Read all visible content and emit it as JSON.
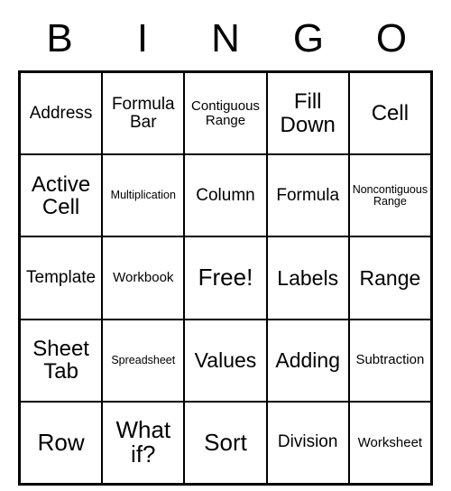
{
  "header": [
    "B",
    "I",
    "N",
    "G",
    "O"
  ],
  "grid": [
    [
      {
        "t": "Address",
        "s": "s-sm"
      },
      {
        "t": "Formula Bar",
        "s": "s-sm"
      },
      {
        "t": "Contiguous Range",
        "s": "s-xs"
      },
      {
        "t": "Fill Down",
        "s": "s-lg"
      },
      {
        "t": "Cell",
        "s": "s-lg"
      }
    ],
    [
      {
        "t": "Active Cell",
        "s": "s-lg"
      },
      {
        "t": "Multiplication",
        "s": "s-xxs"
      },
      {
        "t": "Column",
        "s": "s-sm"
      },
      {
        "t": "Formula",
        "s": "s-sm"
      },
      {
        "t": "Noncontiguous Range",
        "s": "s-xxs"
      }
    ],
    [
      {
        "t": "Template",
        "s": "s-sm"
      },
      {
        "t": "Workbook",
        "s": "s-xs"
      },
      {
        "t": "Free!",
        "s": "s-xl"
      },
      {
        "t": "Labels",
        "s": "s-md"
      },
      {
        "t": "Range",
        "s": "s-md"
      }
    ],
    [
      {
        "t": "Sheet Tab",
        "s": "s-lg"
      },
      {
        "t": "Spreadsheet",
        "s": "s-xxs"
      },
      {
        "t": "Values",
        "s": "s-md"
      },
      {
        "t": "Adding",
        "s": "s-md"
      },
      {
        "t": "Subtraction",
        "s": "s-xs"
      }
    ],
    [
      {
        "t": "Row",
        "s": "s-xl"
      },
      {
        "t": "What if?",
        "s": "s-xl"
      },
      {
        "t": "Sort",
        "s": "s-xl"
      },
      {
        "t": "Division",
        "s": "s-sm"
      },
      {
        "t": "Worksheet",
        "s": "s-xs"
      }
    ]
  ]
}
